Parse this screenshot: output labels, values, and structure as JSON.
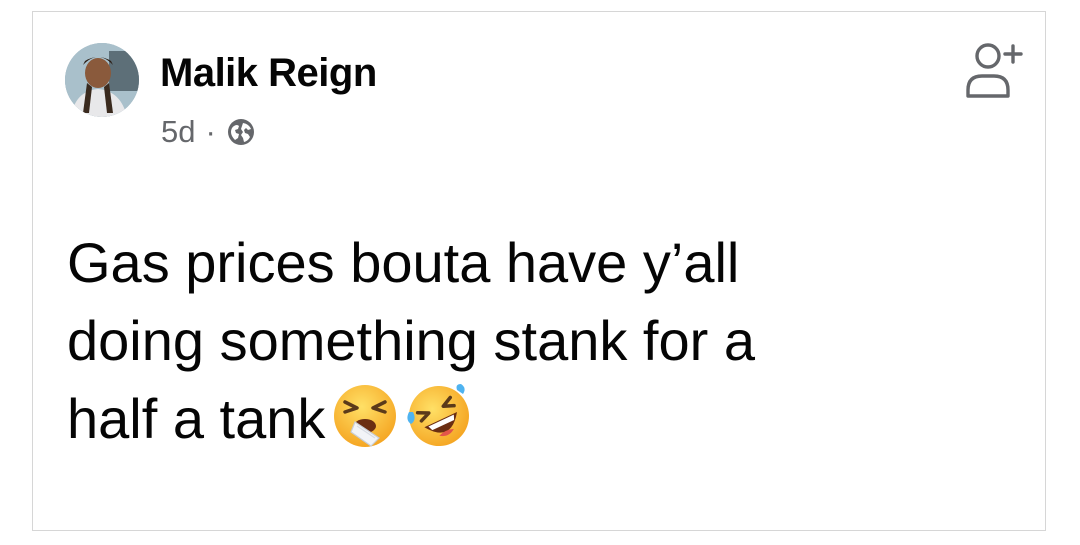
{
  "post": {
    "author": "Malik Reign",
    "time": "5d",
    "separator": "·",
    "privacy_icon": "globe-icon",
    "action_icon": "add-friend-icon",
    "text": "Gas prices bouta have y’all\ndoing something stank for a\nhalf a tank",
    "emojis": [
      "tired-face-emoji",
      "rolling-on-floor-laughing-emoji"
    ]
  },
  "colors": {
    "text_primary": "#050505",
    "text_secondary": "#65676b",
    "border": "#d6d6d6",
    "emoji_yellow": "#f9c02d"
  }
}
